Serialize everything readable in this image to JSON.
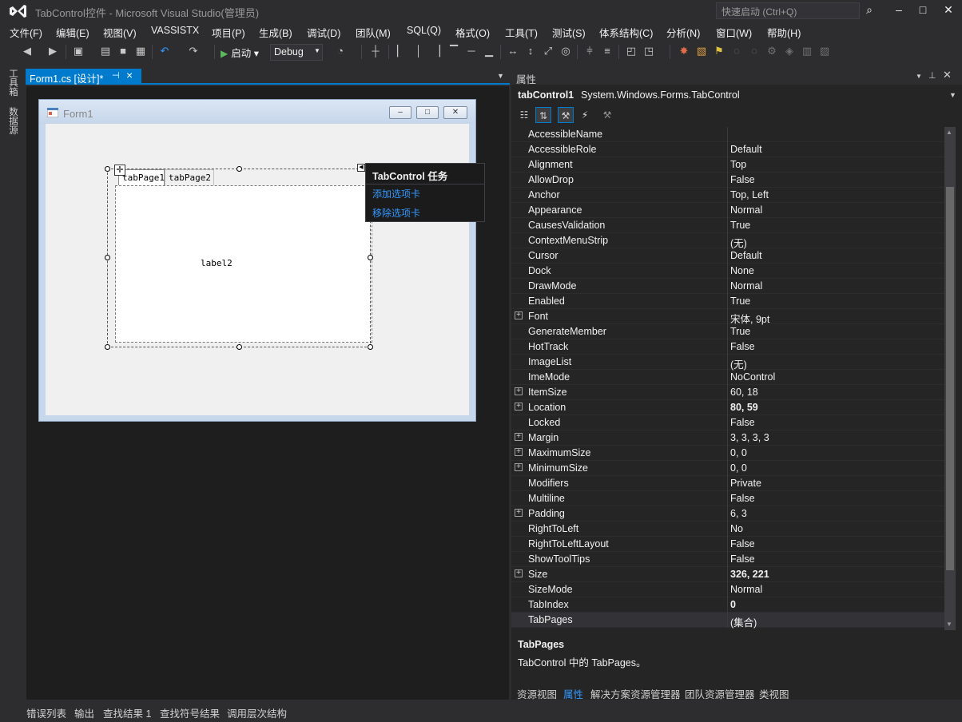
{
  "window": {
    "title": "TabControl控件 - Microsoft Visual Studio(管理员)",
    "quick_launch_placeholder": "快速启动 (Ctrl+Q)"
  },
  "menu": [
    "文件(F)",
    "编辑(E)",
    "视图(V)",
    "VASSISTX",
    "项目(P)",
    "生成(B)",
    "调试(D)",
    "团队(M)",
    "SQL(Q)",
    "格式(O)",
    "工具(T)",
    "测试(S)",
    "体系结构(C)",
    "分析(N)",
    "窗口(W)",
    "帮助(H)"
  ],
  "toolbar": {
    "start_label": "启动",
    "config": "Debug"
  },
  "left_strip": {
    "toolbox": "工具箱",
    "datasource": "数据源"
  },
  "document_tab": {
    "label": "Form1.cs [设计]*"
  },
  "form": {
    "title": "Form1",
    "tabs": [
      "tabPage1",
      "tabPage2"
    ],
    "label_text": "label2"
  },
  "smart_tag": {
    "title": "TabControl 任务",
    "actions": [
      "添加选项卡",
      "移除选项卡"
    ]
  },
  "properties": {
    "title": "属性",
    "object_name": "tabControl1",
    "object_type": "System.Windows.Forms.TabControl",
    "rows": [
      {
        "name": "AccessibleName",
        "value": "",
        "expand": false,
        "bold": false
      },
      {
        "name": "AccessibleRole",
        "value": "Default",
        "expand": false,
        "bold": false
      },
      {
        "name": "Alignment",
        "value": "Top",
        "expand": false,
        "bold": false
      },
      {
        "name": "AllowDrop",
        "value": "False",
        "expand": false,
        "bold": false
      },
      {
        "name": "Anchor",
        "value": "Top, Left",
        "expand": false,
        "bold": false
      },
      {
        "name": "Appearance",
        "value": "Normal",
        "expand": false,
        "bold": false
      },
      {
        "name": "CausesValidation",
        "value": "True",
        "expand": false,
        "bold": false
      },
      {
        "name": "ContextMenuStrip",
        "value": "(无)",
        "expand": false,
        "bold": false
      },
      {
        "name": "Cursor",
        "value": "Default",
        "expand": false,
        "bold": false
      },
      {
        "name": "Dock",
        "value": "None",
        "expand": false,
        "bold": false
      },
      {
        "name": "DrawMode",
        "value": "Normal",
        "expand": false,
        "bold": false
      },
      {
        "name": "Enabled",
        "value": "True",
        "expand": false,
        "bold": false
      },
      {
        "name": "Font",
        "value": "宋体, 9pt",
        "expand": true,
        "bold": false
      },
      {
        "name": "GenerateMember",
        "value": "True",
        "expand": false,
        "bold": false
      },
      {
        "name": "HotTrack",
        "value": "False",
        "expand": false,
        "bold": false
      },
      {
        "name": "ImageList",
        "value": "(无)",
        "expand": false,
        "bold": false
      },
      {
        "name": "ImeMode",
        "value": "NoControl",
        "expand": false,
        "bold": false
      },
      {
        "name": "ItemSize",
        "value": "60, 18",
        "expand": true,
        "bold": false
      },
      {
        "name": "Location",
        "value": "80, 59",
        "expand": true,
        "bold": true
      },
      {
        "name": "Locked",
        "value": "False",
        "expand": false,
        "bold": false
      },
      {
        "name": "Margin",
        "value": "3, 3, 3, 3",
        "expand": true,
        "bold": false
      },
      {
        "name": "MaximumSize",
        "value": "0, 0",
        "expand": true,
        "bold": false
      },
      {
        "name": "MinimumSize",
        "value": "0, 0",
        "expand": true,
        "bold": false
      },
      {
        "name": "Modifiers",
        "value": "Private",
        "expand": false,
        "bold": false
      },
      {
        "name": "Multiline",
        "value": "False",
        "expand": false,
        "bold": false
      },
      {
        "name": "Padding",
        "value": "6, 3",
        "expand": true,
        "bold": false
      },
      {
        "name": "RightToLeft",
        "value": "No",
        "expand": false,
        "bold": false
      },
      {
        "name": "RightToLeftLayout",
        "value": "False",
        "expand": false,
        "bold": false
      },
      {
        "name": "ShowToolTips",
        "value": "False",
        "expand": false,
        "bold": false
      },
      {
        "name": "Size",
        "value": "326, 221",
        "expand": true,
        "bold": true
      },
      {
        "name": "SizeMode",
        "value": "Normal",
        "expand": false,
        "bold": false
      },
      {
        "name": "TabIndex",
        "value": "0",
        "expand": false,
        "bold": true
      },
      {
        "name": "TabPages",
        "value": "(集合)",
        "expand": false,
        "bold": false
      }
    ],
    "description_title": "TabPages",
    "description_text": "TabControl 中的 TabPages。",
    "bottom_tabs": [
      "资源视图",
      "属性",
      "解决方案资源管理器",
      "团队资源管理器",
      "类视图"
    ],
    "active_bottom_tab": "属性"
  },
  "bottom_tabs": [
    "错误列表",
    "输出",
    "查找结果 1",
    "查找符号结果",
    "调用层次结构"
  ],
  "colors": {
    "accent": "#007acc",
    "link": "#3399ff",
    "background": "#2d2d30"
  }
}
